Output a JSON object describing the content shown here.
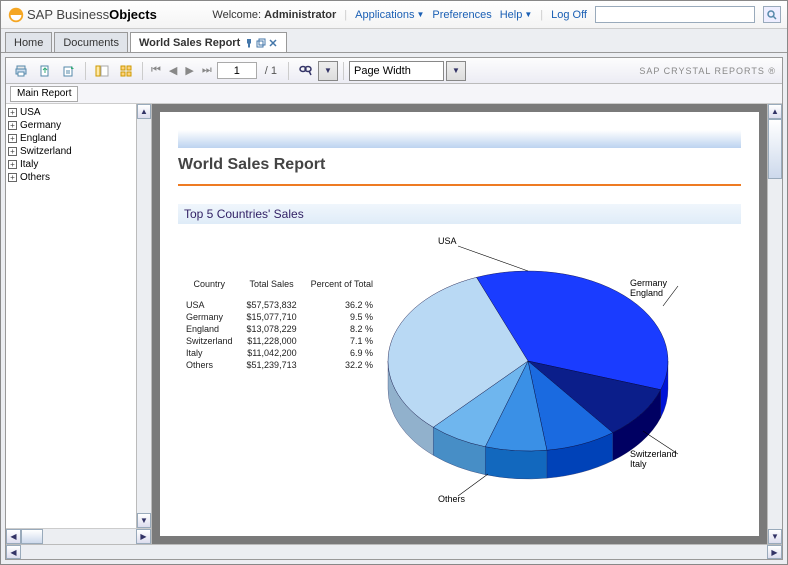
{
  "header": {
    "logo_text1": "SAP Business",
    "logo_text2": "Objects",
    "welcome": "Welcome:",
    "user": "Administrator",
    "links": {
      "applications": "Applications",
      "preferences": "Preferences",
      "help": "Help",
      "logoff": "Log Off"
    }
  },
  "tabs": {
    "home": "Home",
    "documents": "Documents",
    "report": "World Sales Report"
  },
  "toolbar": {
    "page_value": "1",
    "page_total": "/ 1",
    "zoom_value": "Page Width",
    "brand": "SAP CRYSTAL REPORTS ®"
  },
  "sub_tab": "Main Report",
  "tree": [
    "USA",
    "Germany",
    "England",
    "Switzerland",
    "Italy",
    "Others"
  ],
  "report": {
    "title": "World Sales Report",
    "subtitle": "Top 5 Countries' Sales",
    "table_headers": [
      "Country",
      "Total Sales",
      "Percent of Total"
    ],
    "rows": [
      [
        "USA",
        "$57,573,832",
        "36.2  %"
      ],
      [
        "Germany",
        "$15,077,710",
        "9.5  %"
      ],
      [
        "England",
        "$13,078,229",
        "8.2  %"
      ],
      [
        "Switzerland",
        "$11,228,000",
        "7.1  %"
      ],
      [
        "Italy",
        "$11,042,200",
        "6.9  %"
      ],
      [
        "Others",
        "$51,239,713",
        "32.2  %"
      ]
    ],
    "callouts": {
      "usa": "USA",
      "germany": "Germany",
      "england": "England",
      "switz": "Switzerland",
      "italy": "Italy",
      "others": "Others"
    }
  },
  "chart_data": {
    "type": "pie",
    "title": "Top 5 Countries' Sales",
    "categories": [
      "USA",
      "Germany",
      "England",
      "Switzerland",
      "Italy",
      "Others"
    ],
    "values": [
      36.2,
      9.5,
      8.2,
      7.1,
      6.9,
      32.2
    ],
    "ylabel": "Percent of Total",
    "colors": [
      "#1a3cff",
      "#0b1e8a",
      "#1a6ae0",
      "#3a90e6",
      "#6fb6ee",
      "#b9d9f4"
    ]
  }
}
